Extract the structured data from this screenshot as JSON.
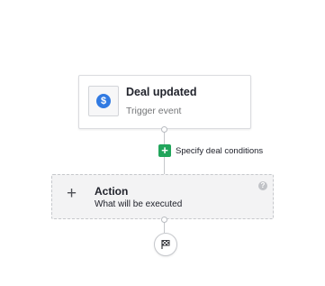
{
  "trigger": {
    "title": "Deal updated",
    "subtitle": "Trigger event",
    "icon": "dollar-icon",
    "icon_glyph": "$",
    "icon_color": "#317ae2"
  },
  "condition": {
    "add_glyph": "+",
    "label": "Specify deal conditions",
    "accent": "#21a55b"
  },
  "action": {
    "plus_glyph": "+",
    "title": "Action",
    "subtitle": "What will be executed",
    "help_glyph": "?"
  },
  "end": {
    "icon": "finish-flag-icon"
  }
}
